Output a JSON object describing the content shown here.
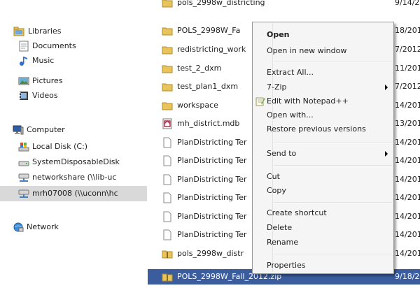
{
  "nav": {
    "libraries": "Libraries",
    "documents": "Documents",
    "music": "Music",
    "pictures": "Pictures",
    "videos": "Videos",
    "computer": "Computer",
    "local_disk": "Local Disk (C:)",
    "system_disk": "SystemDisposableDisk",
    "networkshare": "networkshare (\\\\lib-uc",
    "mrh": "mrh07008 (\\\\uconn\\hc",
    "network": "Network"
  },
  "files": [
    {
      "name": "pols_2998w_districting",
      "date": "9/14/201",
      "type": "folder"
    },
    {
      "name": "POLS_2998W_Fa",
      "date": "18/201",
      "type": "folder"
    },
    {
      "name": "redistricting_work",
      "date": "7/2012",
      "type": "folder"
    },
    {
      "name": "test_2_dxm",
      "date": "11/201",
      "type": "folder"
    },
    {
      "name": "test_plan1_dxm",
      "date": "7/2012",
      "type": "folder"
    },
    {
      "name": "workspace",
      "date": "14/201",
      "type": "folder"
    },
    {
      "name": "mh_district.mdb",
      "date": "13/201",
      "type": "mdb"
    },
    {
      "name": "PlanDistricting Ter",
      "date": "14/201",
      "type": "file"
    },
    {
      "name": "PlanDistricting Ter",
      "date": "14/201",
      "type": "file"
    },
    {
      "name": "PlanDistricting Ter",
      "date": "14/201",
      "type": "file"
    },
    {
      "name": "PlanDistricting Ter",
      "date": "14/201",
      "type": "file"
    },
    {
      "name": "PlanDistricting Ter",
      "date": "14/201",
      "type": "file"
    },
    {
      "name": "PlanDistricting Ter",
      "date": "14/201",
      "type": "file"
    },
    {
      "name": "pols_2998w_distr",
      "date": "14/201",
      "type": "zipfolder"
    },
    {
      "name": "POLS_2998W_Fall_2012.zip",
      "date": "9/18/201",
      "type": "zipfolder"
    }
  ],
  "menu": {
    "open": "Open",
    "open_new_window": "Open in new window",
    "extract_all": "Extract All...",
    "seven_zip": "7-Zip",
    "edit_notepad": "Edit with Notepad++",
    "open_with": "Open with...",
    "restore": "Restore previous versions",
    "send_to": "Send to",
    "cut": "Cut",
    "copy": "Copy",
    "create_shortcut": "Create shortcut",
    "delete": "Delete",
    "rename": "Rename",
    "properties": "Properties"
  },
  "colors": {
    "selection": "#3b5d9e",
    "nav_selected": "#d9d9d9",
    "menu_bg": "#f5f5f5"
  }
}
